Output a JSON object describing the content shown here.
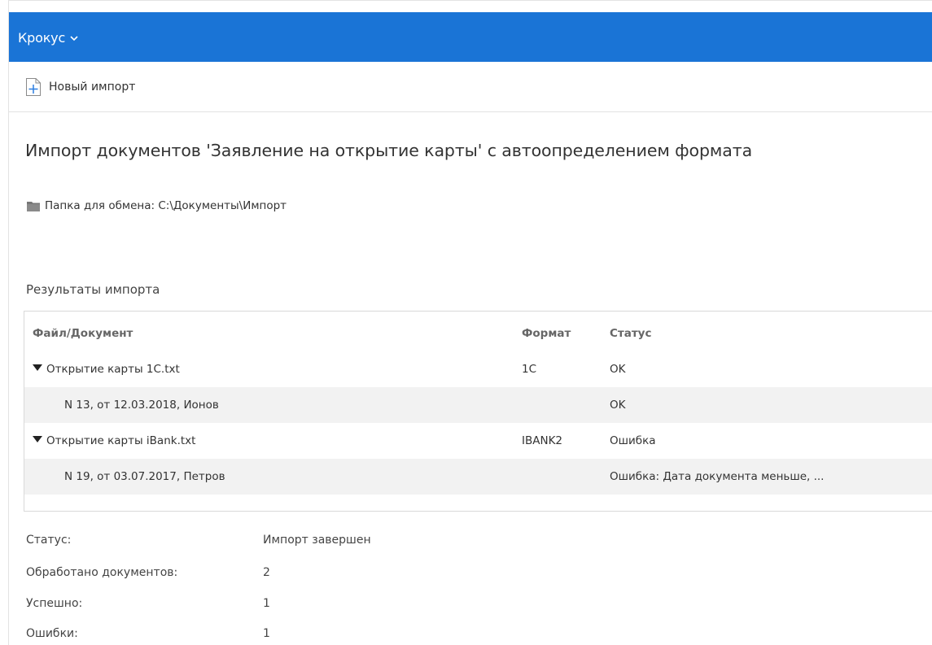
{
  "header": {
    "app_name": "Крокус",
    "bg_color": "#1a74d6"
  },
  "toolbar": {
    "new_import_label": "Новый импорт",
    "new_import_icon": "document-plus-icon"
  },
  "page": {
    "title": "Импорт документов 'Заявление на открытие карты' с автоопределением формата",
    "folder_icon": "folder-icon",
    "folder_text": "Папка для обмена: C:\\Документы\\Импорт"
  },
  "results": {
    "section_title": "Результаты импорта",
    "columns": {
      "document": "Файл/Документ",
      "format": "Формат",
      "status": "Статус"
    },
    "rows": [
      {
        "document": "Открытие карты 1C.txt",
        "format": "1C",
        "status": "OK",
        "level": 0,
        "expanded": true
      },
      {
        "document": "N 13, от 12.03.2018, Ионов",
        "format": "",
        "status": "OK",
        "level": 1
      },
      {
        "document": "Открытие карты iBank.txt",
        "format": "IBANK2",
        "status": "Ошибка",
        "level": 0,
        "expanded": true
      },
      {
        "document": "N 19, от 03.07.2017, Петров",
        "format": "",
        "status": "Ошибка: Дата документа меньше, ...",
        "level": 1
      }
    ]
  },
  "summary": {
    "items": [
      {
        "label": "Статус:",
        "value": "Импорт завершен"
      },
      {
        "label": "Обработано документов:",
        "value": "2"
      },
      {
        "label": "Успешно:",
        "value": "1"
      },
      {
        "label": "Ошибки:",
        "value": "1"
      }
    ]
  }
}
